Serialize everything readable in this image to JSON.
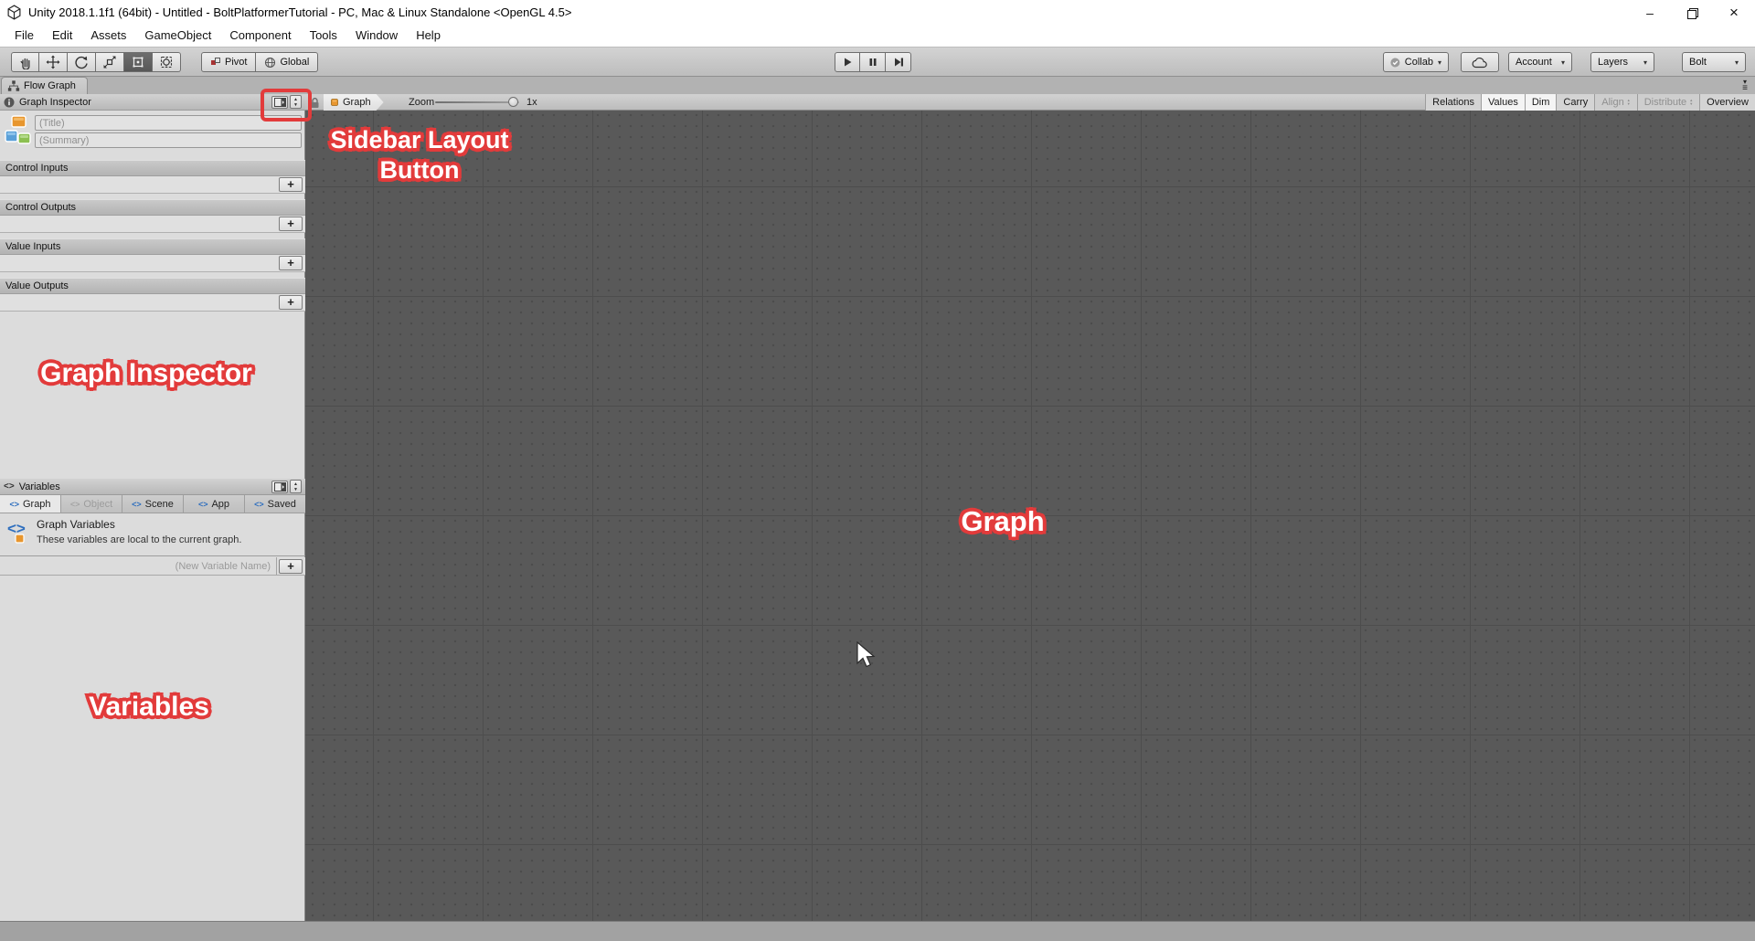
{
  "title_bar": {
    "title": "Unity 2018.1.1f1 (64bit) - Untitled - BoltPlatformerTutorial - PC, Mac & Linux Standalone <OpenGL 4.5>"
  },
  "menu": {
    "items": [
      "File",
      "Edit",
      "Assets",
      "GameObject",
      "Component",
      "Tools",
      "Window",
      "Help"
    ]
  },
  "toolbar": {
    "pivot": "Pivot",
    "global": "Global",
    "collab": "Collab",
    "account": "Account",
    "layers": "Layers",
    "layout": "Bolt"
  },
  "flow_graph_window": {
    "tab": "Flow Graph",
    "inspector": {
      "header": "Graph Inspector",
      "title_placeholder": "(Title)",
      "summary_placeholder": "(Summary)",
      "sections": [
        {
          "label": "Control Inputs"
        },
        {
          "label": "Control Outputs"
        },
        {
          "label": "Value Inputs"
        },
        {
          "label": "Value Outputs"
        }
      ]
    },
    "variables": {
      "header": "Variables",
      "tabs": [
        "Graph",
        "Object",
        "Scene",
        "App",
        "Saved"
      ],
      "active_tab": "Graph",
      "disabled_tab": "Object",
      "info_title": "Graph Variables",
      "info_description": "These variables are local to the current graph.",
      "new_variable_placeholder": "(New Variable Name)"
    },
    "graph_toolbar": {
      "breadcrumb": "Graph",
      "zoom_label": "Zoom",
      "zoom_value": "1x",
      "buttons": [
        {
          "label": "Relations",
          "state": "normal"
        },
        {
          "label": "Values",
          "state": "active"
        },
        {
          "label": "Dim",
          "state": "active"
        },
        {
          "label": "Carry",
          "state": "normal"
        },
        {
          "label": "Align",
          "state": "disabled"
        },
        {
          "label": "Distribute",
          "state": "disabled"
        },
        {
          "label": "Overview",
          "state": "normal"
        }
      ]
    }
  },
  "annotations": {
    "sidebar_layout_button": "Sidebar Layout Button",
    "graph_inspector": "Graph Inspector",
    "graph": "Graph",
    "variables": "Variables",
    "color": "#e23b3b"
  },
  "icons": {
    "plus": "+",
    "dropdown_arrow": "▾",
    "spinner_up": "▲",
    "spinner_down": "▼",
    "menu_lines": "≡",
    "minimize": "–",
    "close": "×",
    "variables_glyph": "<>"
  },
  "colors": {
    "graph_background": "#595959",
    "sidebar_background": "#dcdcdc",
    "annotation_red": "#e23b3b"
  }
}
